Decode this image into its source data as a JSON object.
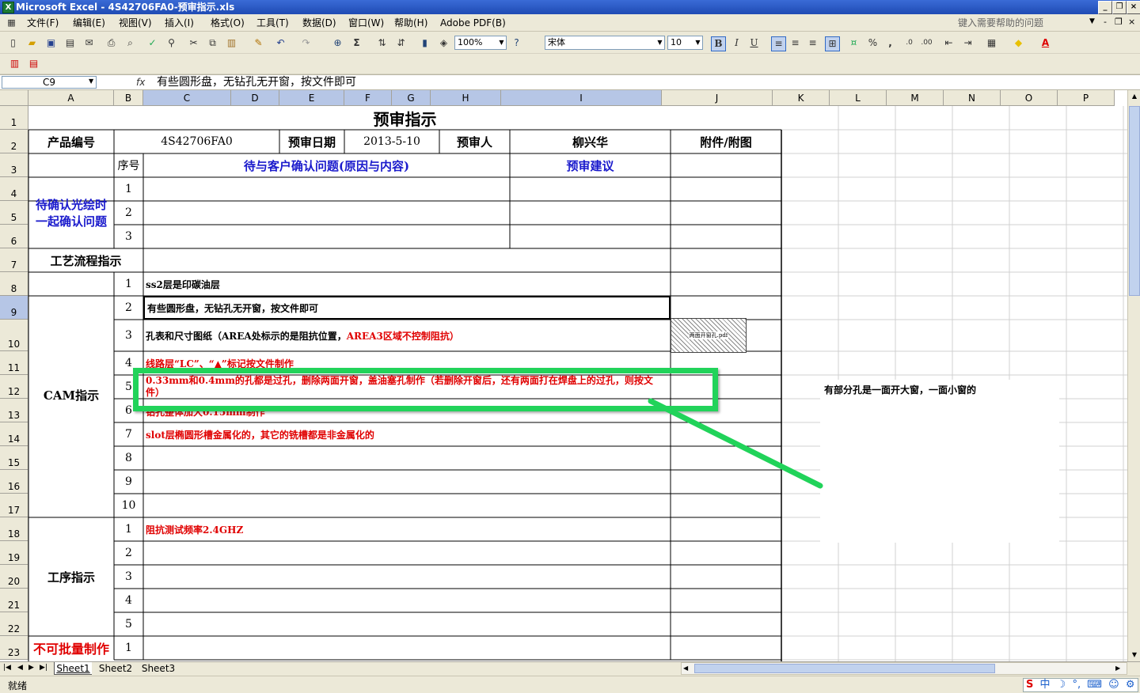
{
  "window": {
    "title": "Microsoft Excel - 4S42706FA0-预审指示.xls"
  },
  "menu": [
    "文件(F)",
    "编辑(E)",
    "视图(V)",
    "插入(I)",
    "格式(O)",
    "工具(T)",
    "数据(D)",
    "窗口(W)",
    "帮助(H)",
    "Adobe PDF(B)"
  ],
  "help_placeholder": "键入需要帮助的问题",
  "toolbar": {
    "zoom": "100%",
    "font": "宋体",
    "size": "10",
    "bold": "B",
    "italic": "I",
    "underline": "U",
    "percent": "%",
    "comma": ",",
    "sigma": "Σ"
  },
  "formula_bar": {
    "cell_ref": "C9",
    "fx": "fx",
    "content": "有些圆形盘，无钻孔无开窗，按文件即可"
  },
  "columns": [
    "A",
    "B",
    "C",
    "D",
    "E",
    "F",
    "G",
    "H",
    "I",
    "J",
    "K",
    "L",
    "M",
    "N",
    "O",
    "P"
  ],
  "rows": [
    "1",
    "2",
    "3",
    "4",
    "5",
    "6",
    "7",
    "8",
    "9",
    "10",
    "11",
    "12",
    "13",
    "14",
    "15",
    "16",
    "17",
    "18",
    "19",
    "20",
    "21",
    "22",
    "23"
  ],
  "sheet": {
    "title": "预审指示",
    "product_label": "产品编号",
    "product_no": "4S42706FA0",
    "review_date_label": "预审日期",
    "review_date": "2013-5-10",
    "reviewer_label": "预审人",
    "reviewer": "柳兴华",
    "attachment_label": "附件/附图",
    "seq_label": "序号",
    "confirm_issue_header": "待与客户确认问题(原因与内容)",
    "review_suggest_header": "预审建议",
    "confirm_section": "待确认光绘时一起确认问题",
    "process_section": "工艺流程指示",
    "cam_section": "CAM指示",
    "step_section": "工序指示",
    "no_batch_section": "不可批量制作",
    "confirm_nums": [
      "1",
      "2",
      "3"
    ],
    "cam_nums": [
      "1",
      "2",
      "3",
      "4",
      "5",
      "6",
      "7",
      "8",
      "9",
      "10"
    ],
    "step_nums": [
      "1",
      "2",
      "3",
      "4",
      "5"
    ],
    "no_batch_nums": [
      "1"
    ],
    "cam_items": [
      "ss2层是印碳油层",
      "有些圆形盘，无钻孔无开窗，按文件即可",
      "孔表和尺寸图纸（AREA处标示的是阻抗位置，",
      "线路层“LC”、“▲”标记按文件制作",
      "0.33mm和0.4mm的孔都是过孔，删除两面开窗，盖油塞孔制作（若删除开窗后，还有两面打在焊盘上的过孔，则按文件）",
      "钻孔整体加大0.15mm制作",
      "slot层椭圆形槽金属化的，其它的铣槽都是非金属化的"
    ],
    "cam_item3_red": "AREA3区域不控制阻抗）",
    "step_items": [
      "阻抗测试频率2.4GHZ"
    ],
    "attachment_thumb": "两面开窗孔.pdf",
    "comment_text": "有部分孔是一面开大窗，一面小窗的"
  },
  "sheet_tabs": [
    "Sheet1",
    "Sheet2",
    "Sheet3"
  ],
  "status": {
    "ready": "就绪"
  },
  "ime": {
    "lang": "中"
  }
}
